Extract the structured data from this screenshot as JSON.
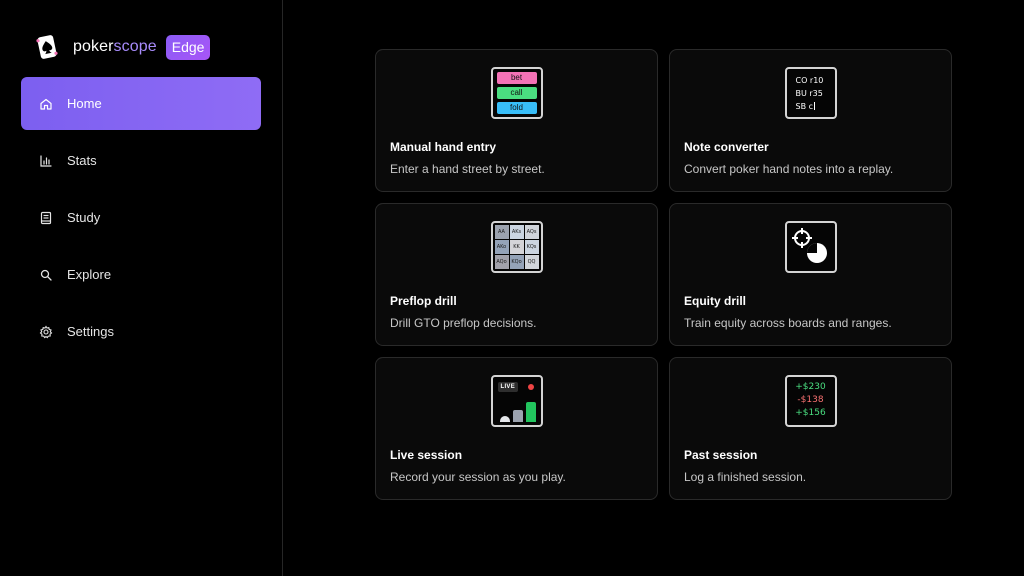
{
  "brand": {
    "name_part1": "poker",
    "name_part2": "scope",
    "badge": "Edge",
    "logo_icon": "spade-card-logo-icon"
  },
  "sidebar": {
    "items": [
      {
        "label": "Home",
        "icon": "home-icon",
        "active": true
      },
      {
        "label": "Stats",
        "icon": "bar-chart-icon",
        "active": false
      },
      {
        "label": "Study",
        "icon": "book-icon",
        "active": false
      },
      {
        "label": "Explore",
        "icon": "search-icon",
        "active": false
      },
      {
        "label": "Settings",
        "icon": "gear-icon",
        "active": false
      }
    ]
  },
  "cards": [
    {
      "title": "Manual hand entry",
      "description": "Enter a hand street by street.",
      "icon": "action-pills-icon",
      "pills": [
        "bet",
        "call",
        "fold"
      ]
    },
    {
      "title": "Note converter",
      "description": "Convert poker hand notes into a replay.",
      "icon": "notes-text-icon",
      "lines": [
        "CO r10",
        "BU r35",
        "SB c"
      ]
    },
    {
      "title": "Preflop drill",
      "description": "Drill GTO preflop decisions.",
      "icon": "range-grid-icon",
      "grid": [
        "AA",
        "AKs",
        "AQs",
        "AKo",
        "KK",
        "KQs",
        "AQo",
        "KQo",
        "QQ"
      ]
    },
    {
      "title": "Equity drill",
      "description": "Train equity across boards and ranges.",
      "icon": "crosshair-pie-icon"
    },
    {
      "title": "Live session",
      "description": "Record your session as you play.",
      "icon": "live-bars-icon",
      "tag": "LIVE"
    },
    {
      "title": "Past session",
      "description": "Log a finished session.",
      "icon": "results-list-icon",
      "results": [
        "+$230",
        "-$138",
        "+$156"
      ]
    }
  ],
  "colors": {
    "accent": "#8b5cf6",
    "positive": "#4ade80",
    "negative": "#f87171",
    "live": "#ef4444"
  }
}
